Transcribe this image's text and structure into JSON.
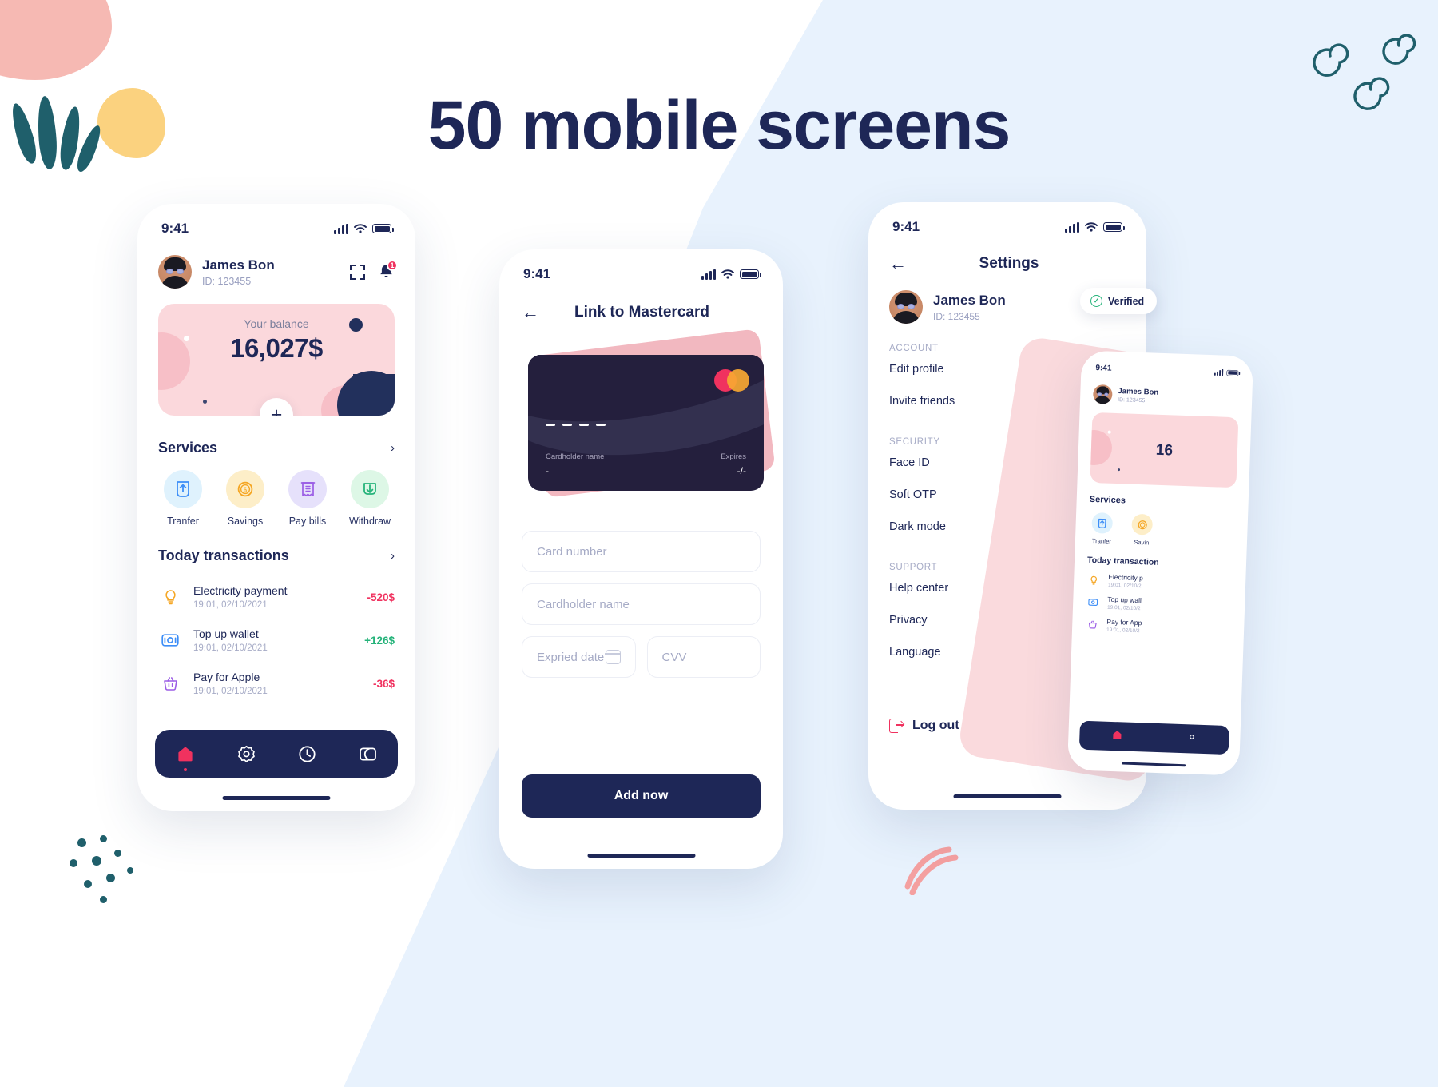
{
  "page": {
    "title": "50 mobile screens",
    "accent_navy": "#1e2757",
    "accent_pink": "#fbd8dc",
    "accent_red": "#f0325f",
    "accent_green": "#25b37a",
    "bg_blue": "#e8f2fd"
  },
  "home_screen": {
    "status": {
      "time": "9:41",
      "signal_icon": "signal-icon",
      "wifi_icon": "wifi-icon",
      "battery_icon": "battery-icon"
    },
    "user": {
      "name": "James Bon",
      "id": "ID: 123455",
      "avatar_icon": "avatar"
    },
    "actions": {
      "scan_icon": "scan-icon",
      "bell_icon": "bell-icon",
      "notification_count": "1"
    },
    "balance": {
      "label": "Your balance",
      "amount": "16,027$",
      "add_icon": "plus-icon"
    },
    "services": {
      "title": "Services",
      "more_icon": "chevron-right-icon",
      "items": [
        {
          "label": "Tranfer",
          "icon": "transfer-icon",
          "bg": "#dff2fd",
          "color": "#3d8ef7"
        },
        {
          "label": "Savings",
          "icon": "savings-icon",
          "bg": "#fdeec8",
          "color": "#f5a623"
        },
        {
          "label": "Pay bills",
          "icon": "bill-icon",
          "bg": "#e6e1fb",
          "color": "#9b5de5"
        },
        {
          "label": "Withdraw",
          "icon": "withdraw-icon",
          "bg": "#ddf7e6",
          "color": "#25b37a"
        }
      ]
    },
    "transactions": {
      "title": "Today transactions",
      "more_icon": "chevron-right-icon",
      "items": [
        {
          "name": "Electricity payment",
          "time": "19:01, 02/10/2021",
          "amount": "-520$",
          "sign": "neg",
          "icon": "bulb-icon",
          "color": "#f5a623"
        },
        {
          "name": "Top up wallet",
          "time": "19:01, 02/10/2021",
          "amount": "+126$",
          "sign": "pos",
          "icon": "money-icon",
          "color": "#3d8ef7"
        },
        {
          "name": "Pay for Apple",
          "time": "19:01, 02/10/2021",
          "amount": "-36$",
          "sign": "neg",
          "icon": "basket-icon",
          "color": "#9b5de5"
        }
      ]
    },
    "tabs": [
      {
        "icon": "home-icon",
        "active": true
      },
      {
        "icon": "gear-icon",
        "active": false
      },
      {
        "icon": "history-icon",
        "active": false
      },
      {
        "icon": "card-icon",
        "active": false
      }
    ]
  },
  "card_screen": {
    "status": {
      "time": "9:41"
    },
    "back_icon": "back-arrow-icon",
    "title": "Link to Mastercard",
    "card": {
      "number_mask": "- - - -",
      "cardholder_label": "Cardholder name",
      "cardholder_value": "-",
      "expires_label": "Expires",
      "expires_value": "-/-",
      "brand_icon": "mastercard-icon"
    },
    "form": {
      "card_number_placeholder": "Card number",
      "cardholder_placeholder": "Cardholder name",
      "expiry_placeholder": "Expried date",
      "cvv_placeholder": "CVV",
      "calendar_icon": "calendar-icon"
    },
    "submit_label": "Add now"
  },
  "settings_screen": {
    "status": {
      "time": "9:41"
    },
    "back_icon": "back-arrow-icon",
    "title": "Settings",
    "user": {
      "name": "James Bon",
      "id": "ID: 123455"
    },
    "verified_badge": {
      "label": "Verified",
      "icon": "check-circle-icon"
    },
    "groups": [
      {
        "label": "ACCOUNT",
        "items": [
          {
            "label": "Edit profile",
            "type": "link",
            "icon": "chevron-right-icon"
          },
          {
            "label": "Invite friends",
            "type": "link",
            "icon": "chevron-right-icon"
          }
        ]
      },
      {
        "label": "SECURITY",
        "items": [
          {
            "label": "Face ID",
            "type": "toggle",
            "state": "on"
          },
          {
            "label": "Soft OTP",
            "type": "toggle",
            "state": "off"
          },
          {
            "label": "Dark mode",
            "type": "toggle",
            "state": "off"
          }
        ]
      },
      {
        "label": "SUPPORT",
        "items": [
          {
            "label": "Help center",
            "type": "link",
            "icon": "chevron-right-icon"
          },
          {
            "label": "Privacy",
            "type": "link",
            "icon": "chevron-right-icon"
          },
          {
            "label": "Language",
            "type": "link",
            "icon": "chevron-right-icon",
            "flag": "uk-flag-icon"
          }
        ]
      }
    ],
    "logout": {
      "label": "Log out",
      "icon": "logout-icon"
    }
  },
  "mini_screen": {
    "status": {
      "time": "9:41"
    },
    "user": {
      "name": "James Bon",
      "id": "ID: 123455"
    },
    "balance_amount": "16",
    "services_title": "Services",
    "services": [
      {
        "label": "Tranfer",
        "bg": "#dff2fd",
        "color": "#3d8ef7"
      },
      {
        "label": "Savin",
        "bg": "#fdeec8",
        "color": "#f5a623"
      }
    ],
    "transactions_title": "Today transaction",
    "transactions": [
      {
        "name": "Electricity p",
        "time": "19:01, 02/10/2",
        "color": "#f5a623",
        "icon": "bulb-icon"
      },
      {
        "name": "Top up wall",
        "time": "19:01, 02/10/2",
        "color": "#3d8ef7",
        "icon": "money-icon"
      },
      {
        "name": "Pay for App",
        "time": "19:01, 02/10/2",
        "color": "#9b5de5",
        "icon": "basket-icon"
      }
    ]
  }
}
